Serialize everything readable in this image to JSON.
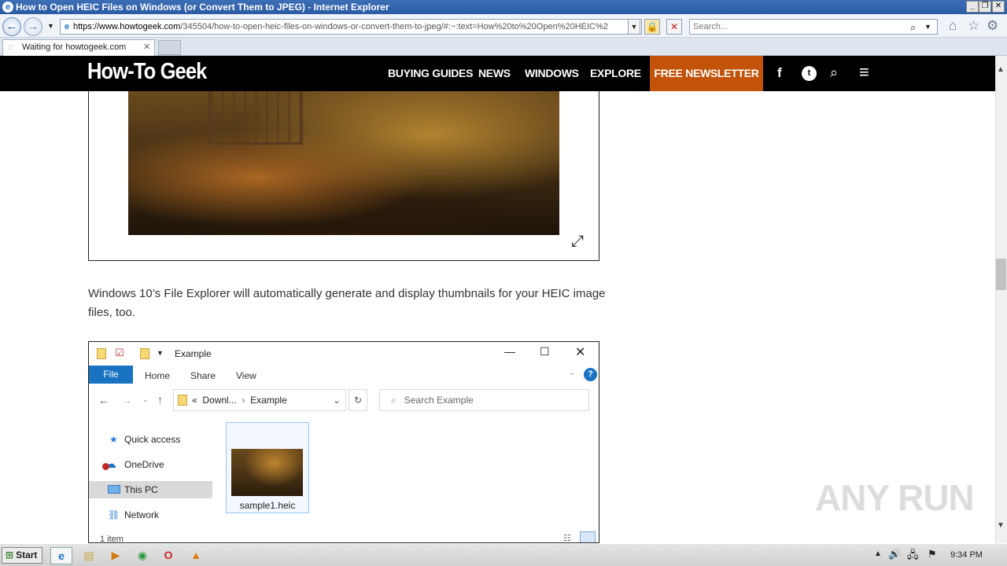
{
  "window": {
    "title": "How to Open HEIC Files on Windows (or Convert Them to JPEG) - Internet Explorer"
  },
  "address": {
    "host": "https://www.howtogeek.com",
    "path": "/345504/how-to-open-heic-files-on-windows-or-convert-them-to-jpeg/#:~:text=How%20to%20Open%20HEIC%2"
  },
  "search": {
    "placeholder": "Search..."
  },
  "tab": {
    "label": "Waiting for howtogeek.com"
  },
  "site": {
    "logo": "How-To Geek",
    "nav": [
      "BUYING GUIDES",
      "NEWS",
      "WINDOWS",
      "EXPLORE"
    ],
    "newsletter": "FREE NEWSLETTER"
  },
  "article": {
    "paragraph": "Windows 10’s File Explorer will automatically generate and display thumbnails for your HEIC image files, too."
  },
  "explorer": {
    "title": "Example",
    "ribbon": {
      "file": "File",
      "home": "Home",
      "share": "Share",
      "view": "View"
    },
    "breadcrumb": {
      "prefix": "«",
      "parent": "Downl...",
      "current": "Example"
    },
    "search_placeholder": "Search Example",
    "sidebar": [
      "Quick access",
      "OneDrive",
      "This PC",
      "Network"
    ],
    "file_name": "sample1.heic",
    "status": "1 item"
  },
  "taskbar": {
    "start": "Start",
    "time": "9:34 PM"
  },
  "watermark": "ANY RUN",
  "colors": {
    "accent": "#c25309",
    "title_bar": "#2a5aa3",
    "explorer_blue": "#1a73c2"
  }
}
